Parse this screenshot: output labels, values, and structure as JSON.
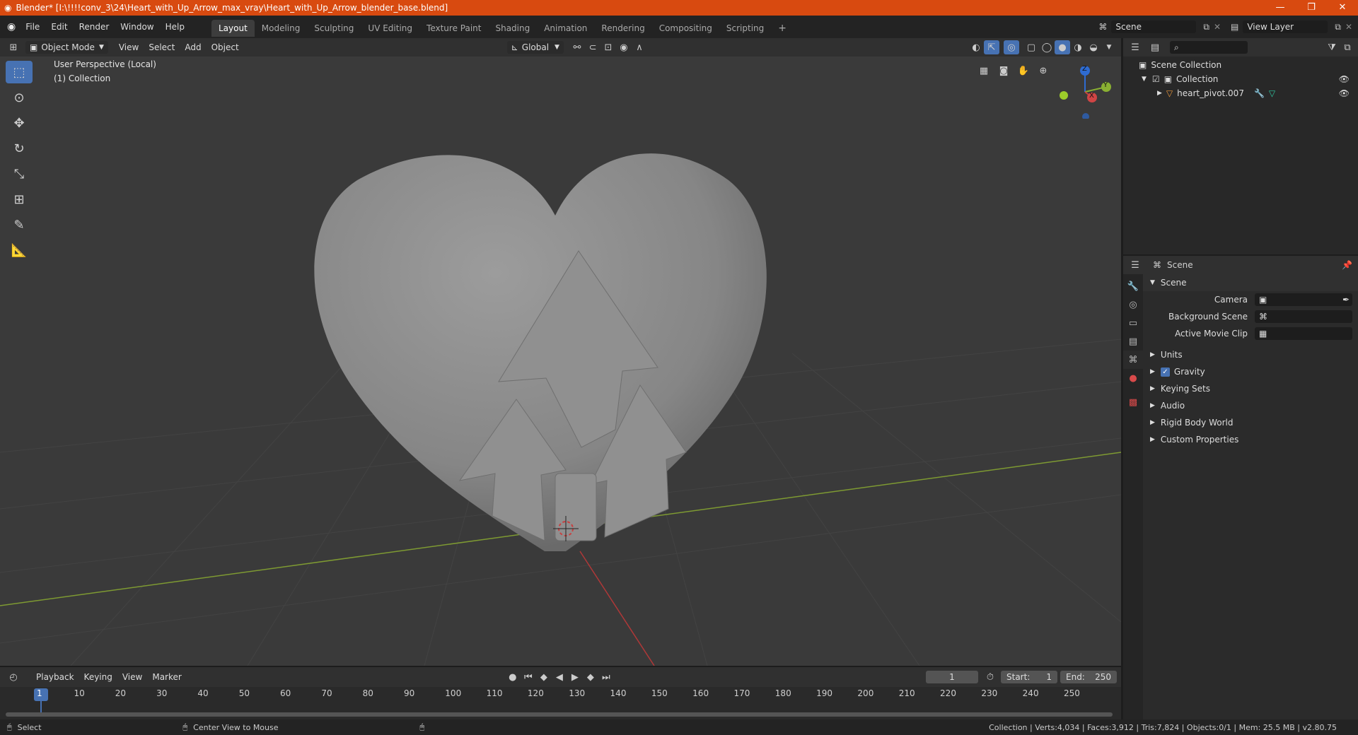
{
  "window": {
    "title": "Blender* [I:\\!!!!conv_3\\24\\Heart_with_Up_Arrow_max_vray\\Heart_with_Up_Arrow_blender_base.blend]",
    "controls": [
      "—",
      "❐",
      "✕"
    ]
  },
  "menu": [
    "File",
    "Edit",
    "Render",
    "Window",
    "Help"
  ],
  "workspaces": [
    "Layout",
    "Modeling",
    "Sculpting",
    "UV Editing",
    "Texture Paint",
    "Shading",
    "Animation",
    "Rendering",
    "Compositing",
    "Scripting"
  ],
  "add_workspace": "+",
  "scene_field": "Scene",
  "view_layer_field": "View Layer",
  "viewport_header": {
    "mode": "Object Mode",
    "menus": [
      "View",
      "Select",
      "Add",
      "Object"
    ],
    "orientation": "Global"
  },
  "viewport": {
    "perspective_label": "User Perspective (Local)",
    "collection_label": "(1) Collection",
    "gizmo_axes": {
      "z": "Z",
      "y": "Y",
      "x": "X"
    }
  },
  "outliner": {
    "items": [
      {
        "label": "Scene Collection"
      },
      {
        "label": "Collection"
      },
      {
        "label": "heart_pivot.007"
      }
    ]
  },
  "properties": {
    "header_title": "Scene",
    "panel_title": "Scene",
    "fields": [
      {
        "label": "Camera"
      },
      {
        "label": "Background Scene"
      },
      {
        "label": "Active Movie Clip"
      }
    ],
    "subpanels": [
      "Units",
      "Gravity",
      "Keying Sets",
      "Audio",
      "Rigid Body World",
      "Custom Properties"
    ]
  },
  "timeline": {
    "menus": [
      "Playback",
      "Keying",
      "View",
      "Marker"
    ],
    "current_frame": "1",
    "start_label": "Start:",
    "start_value": "1",
    "end_label": "End:",
    "end_value": "250",
    "ticks": [
      "1",
      "10",
      "20",
      "30",
      "40",
      "50",
      "60",
      "70",
      "80",
      "90",
      "100",
      "110",
      "120",
      "130",
      "140",
      "150",
      "160",
      "170",
      "180",
      "190",
      "200",
      "210",
      "220",
      "230",
      "240",
      "250"
    ]
  },
  "statusbar": {
    "left_action": "Select",
    "middle_action": "Center View to Mouse",
    "stats": "Collection | Verts:4,034 | Faces:3,912 | Tris:7,824 | Objects:0/1 | Mem: 25.5 MB | v2.80.75"
  },
  "colors": {
    "title_bar": "#d84a10",
    "accent": "#4772b3",
    "viewport_bg": "#3a3a3a",
    "x_axis": "#c84040",
    "y_axis": "#8ab032"
  }
}
